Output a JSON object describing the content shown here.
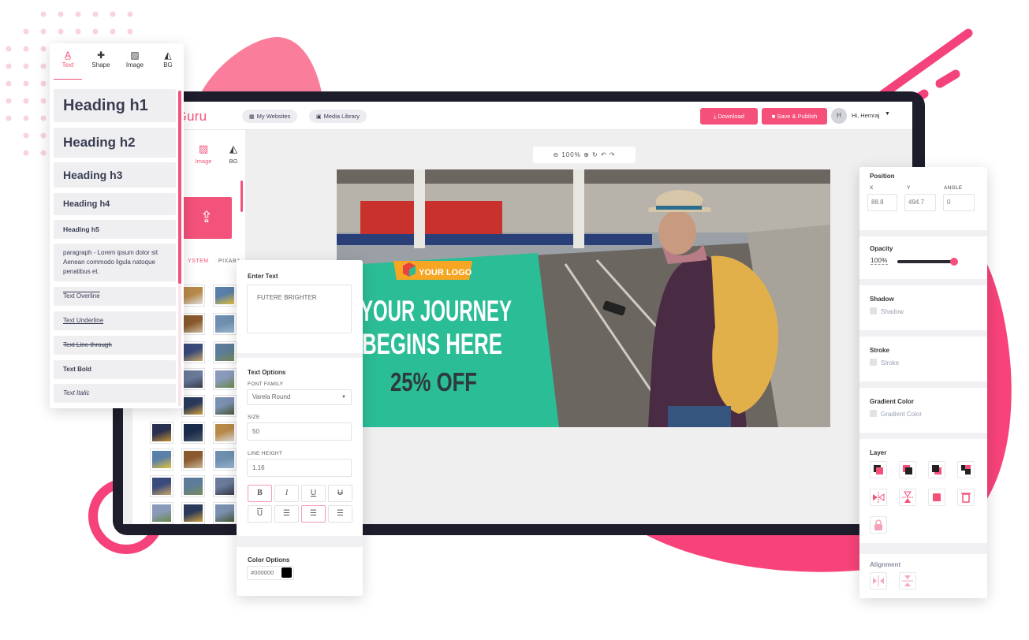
{
  "app": {
    "logo_text": "aGuru",
    "nav": {
      "my_websites": "My Websites",
      "media_library": "Media Library"
    },
    "actions": {
      "download": "Download",
      "save_publish": "Save & Publish"
    },
    "user": {
      "initial": "H",
      "greeting": "Hi, Hemraj"
    }
  },
  "element_tabs": [
    {
      "label": "Text",
      "icon": "text-icon"
    },
    {
      "label": "Shape",
      "icon": "puzzle-icon"
    },
    {
      "label": "Image",
      "icon": "image-icon"
    },
    {
      "label": "BG",
      "icon": "paint-bucket-icon"
    }
  ],
  "inner_tabs": {
    "image": "Image",
    "bg": "BG"
  },
  "source_tabs": {
    "system": "YSTEM",
    "pixabay": "PIXABA"
  },
  "text_items": {
    "h1": "Heading h1",
    "h2": "Heading h2",
    "h3": "Heading h3",
    "h4": "Heading h4",
    "h5": "Heading h5",
    "paragraph": "paragraph - Lorem ipsum dolor sit Aenean commodo ligula natoque penatibus et.",
    "overline": "Text Overline",
    "underline": "Text Underline",
    "linethrough": "Text Line-through",
    "bold": "Text Bold",
    "italic": "Text Italic"
  },
  "zoom": {
    "level": "100%"
  },
  "banner": {
    "logo": "YOUR LOGO",
    "line1": "YOUR JOURNEY",
    "line2": "BEGINS HERE",
    "offer": "25% OFF"
  },
  "text_options": {
    "enter_text_title": "Enter Text",
    "enter_text_value": "FUTERE BRIGHTER",
    "section_title": "Text Options",
    "font_family_label": "FONT FAMILY",
    "font_family_value": "Varela Round",
    "size_label": "SIZE",
    "size_value": "50",
    "line_height_label": "LINE HEIGHT",
    "line_height_value": "1.16",
    "bold_glyph": "B",
    "italic_glyph": "I",
    "underline_glyph": "U",
    "strike_glyph": "U",
    "overline_glyph": "U",
    "color_title": "Color Options",
    "color_value": "#000000"
  },
  "properties": {
    "position_title": "Position",
    "x_label": "X",
    "y_label": "Y",
    "angle_label": "ANGLE",
    "x_value": "88.8",
    "y_value": "494.7",
    "angle_value": "0",
    "opacity_title": "Opacity",
    "opacity_value": "100%",
    "opacity_level": 1.0,
    "shadow_title": "Shadow",
    "shadow_check": "Shadow",
    "stroke_title": "Stroke",
    "stroke_check": "Stroke",
    "gradient_title": "Gradient Color",
    "gradient_check": "Gradient Color",
    "layer_title": "Layer",
    "alignment_title": "Alignment"
  },
  "colors": {
    "accent": "#f4507a",
    "banner_green": "#2bbd96",
    "logo_orange": "#f6a623",
    "monitor": "#1d1d2b"
  }
}
